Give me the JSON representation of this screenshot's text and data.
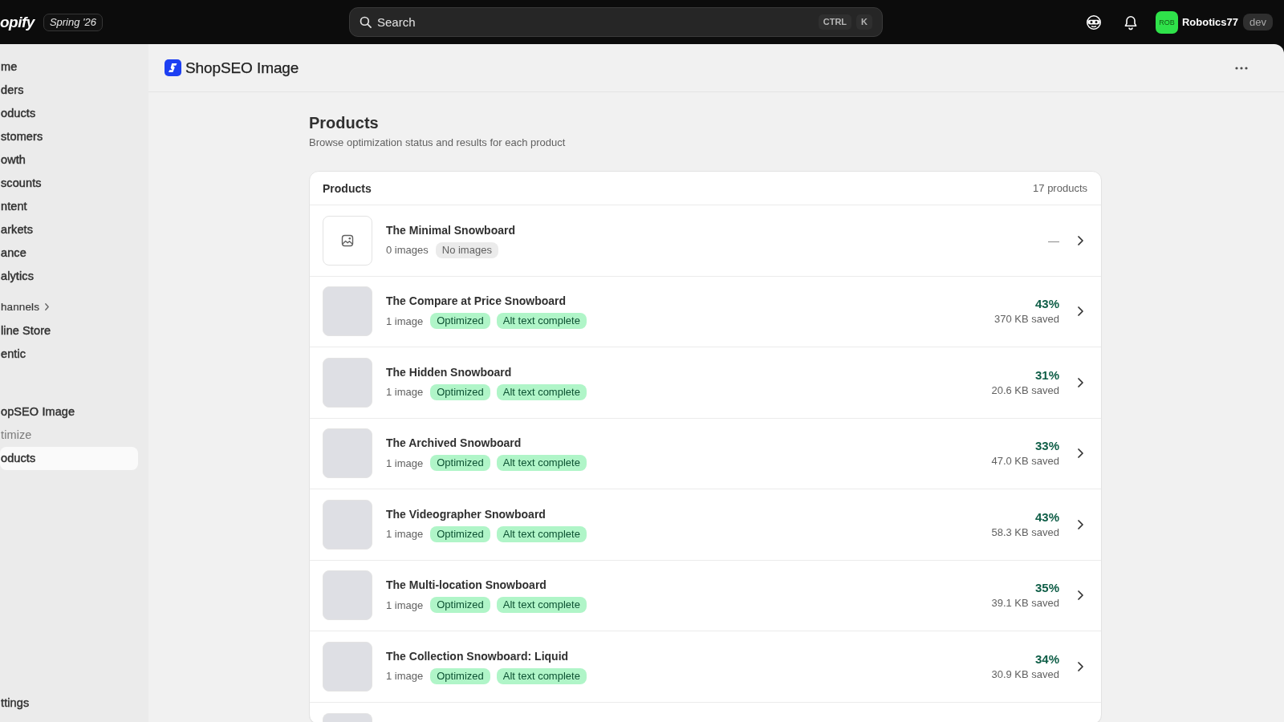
{
  "top_bar": {
    "logo": "opify",
    "release_badge": "Spring '26",
    "search": {
      "placeholder": "Search",
      "shortcut_keys": [
        "CTRL",
        "K"
      ]
    },
    "account": {
      "initials": "ROB",
      "store_name": "Robotics77",
      "badge": "dev"
    }
  },
  "sidebar": {
    "items": [
      {
        "label": "me",
        "kind": "nav",
        "selected": false
      },
      {
        "label": "ders",
        "kind": "nav",
        "selected": false
      },
      {
        "label": "oducts",
        "kind": "nav",
        "selected": false
      },
      {
        "label": "stomers",
        "kind": "nav",
        "selected": false
      },
      {
        "label": "owth",
        "kind": "nav",
        "selected": false
      },
      {
        "label": "scounts",
        "kind": "nav",
        "selected": false
      },
      {
        "label": "ntent",
        "kind": "nav",
        "selected": false
      },
      {
        "label": "arkets",
        "kind": "nav",
        "selected": false
      },
      {
        "label": "ance",
        "kind": "nav",
        "selected": false
      },
      {
        "label": "alytics",
        "kind": "nav",
        "selected": false
      },
      {
        "label": "hannels",
        "kind": "section",
        "selected": false
      },
      {
        "label": "line Store",
        "kind": "nav",
        "selected": false
      },
      {
        "label": "entic",
        "kind": "nav",
        "selected": false
      },
      {
        "label": "opSEO Image",
        "kind": "app",
        "selected": false
      },
      {
        "label": "timize",
        "kind": "subnav",
        "selected": false
      },
      {
        "label": "oducts",
        "kind": "subnav",
        "selected": true
      }
    ],
    "footer_item": "ttings"
  },
  "app_header": {
    "title": "ShopSEO Image"
  },
  "page": {
    "title": "Products",
    "subtitle": "Browse optimization status and results for each product"
  },
  "products_card": {
    "title": "Products",
    "count": "17 products",
    "rows": [
      {
        "kind": "empty",
        "name": "The Minimal Snowboard",
        "image_count": "0 images",
        "badges": [
          {
            "label": "No images",
            "kind": "neutral"
          }
        ],
        "result": "—"
      },
      {
        "kind": "optimized",
        "name": "The Compare at Price Snowboard",
        "image_count": "1 image",
        "badges": [
          {
            "label": "Optimized",
            "kind": "success"
          },
          {
            "label": "Alt text complete",
            "kind": "success"
          }
        ],
        "percent": "43%",
        "saved": "370 KB saved"
      },
      {
        "kind": "optimized",
        "name": "The Hidden Snowboard",
        "image_count": "1 image",
        "badges": [
          {
            "label": "Optimized",
            "kind": "success"
          },
          {
            "label": "Alt text complete",
            "kind": "success"
          }
        ],
        "percent": "31%",
        "saved": "20.6 KB saved"
      },
      {
        "kind": "optimized",
        "name": "The Archived Snowboard",
        "image_count": "1 image",
        "badges": [
          {
            "label": "Optimized",
            "kind": "success"
          },
          {
            "label": "Alt text complete",
            "kind": "success"
          }
        ],
        "percent": "33%",
        "saved": "47.0 KB saved"
      },
      {
        "kind": "optimized",
        "name": "The Videographer Snowboard",
        "image_count": "1 image",
        "badges": [
          {
            "label": "Optimized",
            "kind": "success"
          },
          {
            "label": "Alt text complete",
            "kind": "success"
          }
        ],
        "percent": "43%",
        "saved": "58.3 KB saved"
      },
      {
        "kind": "optimized",
        "name": "The Multi-location Snowboard",
        "image_count": "1 image",
        "badges": [
          {
            "label": "Optimized",
            "kind": "success"
          },
          {
            "label": "Alt text complete",
            "kind": "success"
          }
        ],
        "percent": "35%",
        "saved": "39.1 KB saved"
      },
      {
        "kind": "optimized",
        "name": "The Collection Snowboard: Liquid",
        "image_count": "1 image",
        "badges": [
          {
            "label": "Optimized",
            "kind": "success"
          },
          {
            "label": "Alt text complete",
            "kind": "success"
          }
        ],
        "percent": "34%",
        "saved": "30.9 KB saved"
      },
      {
        "kind": "partial"
      }
    ]
  }
}
